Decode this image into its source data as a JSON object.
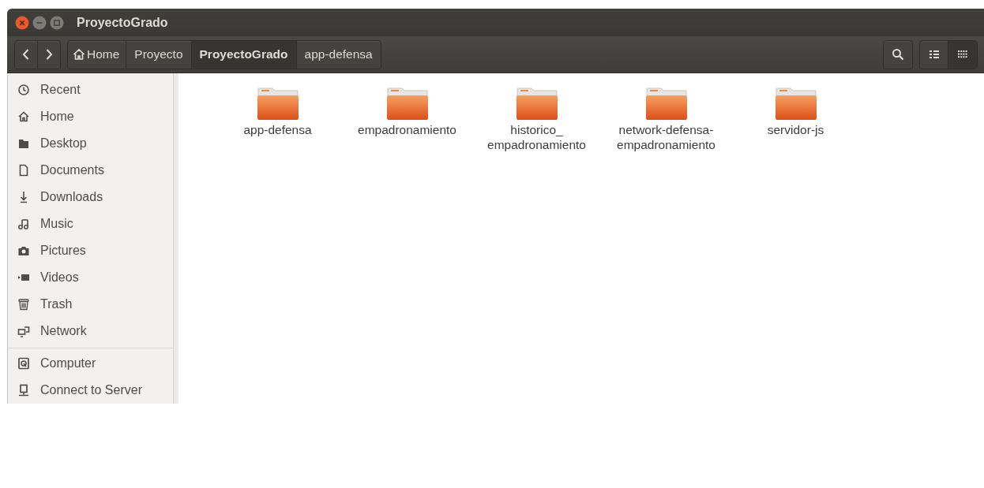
{
  "window": {
    "title": "ProyectoGrado"
  },
  "breadcrumbs": [
    {
      "label": "Home",
      "kind": "home",
      "selected": false
    },
    {
      "label": "Proyecto",
      "kind": "folder",
      "selected": false
    },
    {
      "label": "ProyectoGrado",
      "kind": "folder",
      "selected": true
    },
    {
      "label": "app-defensa",
      "kind": "folder",
      "selected": false
    }
  ],
  "view_buttons": [
    {
      "kind": "list",
      "selected": false
    },
    {
      "kind": "grid",
      "selected": true
    }
  ],
  "sidebar": {
    "groups": [
      {
        "items": [
          {
            "label": "Recent",
            "kind": "recent"
          },
          {
            "label": "Home",
            "kind": "home"
          },
          {
            "label": "Desktop",
            "kind": "desktop"
          },
          {
            "label": "Documents",
            "kind": "documents"
          },
          {
            "label": "Downloads",
            "kind": "downloads"
          },
          {
            "label": "Music",
            "kind": "music"
          },
          {
            "label": "Pictures",
            "kind": "pictures"
          },
          {
            "label": "Videos",
            "kind": "videos"
          },
          {
            "label": "Trash",
            "kind": "trash"
          },
          {
            "label": "Network",
            "kind": "network"
          }
        ]
      },
      {
        "items": [
          {
            "label": "Computer",
            "kind": "computer"
          },
          {
            "label": "Connect to Server",
            "kind": "server"
          }
        ]
      }
    ]
  },
  "folders": [
    {
      "name": "app-defensa"
    },
    {
      "name": "empadronamiento"
    },
    {
      "name": "historico_empadronamiento"
    },
    {
      "name": "network-defensa-empadronamiento"
    },
    {
      "name": "servidor-js"
    }
  ]
}
